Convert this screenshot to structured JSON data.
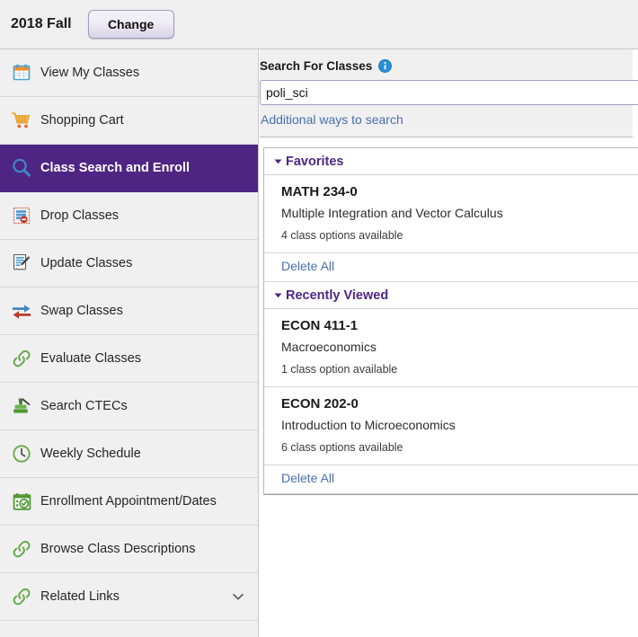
{
  "topbar": {
    "term": "2018 Fall",
    "change_label": "Change"
  },
  "sidebar": {
    "items": [
      {
        "label": "View My Classes",
        "icon": "calendar-icon",
        "active": false
      },
      {
        "label": "Shopping Cart",
        "icon": "shopping-cart-icon",
        "active": false
      },
      {
        "label": "Class Search and Enroll",
        "icon": "magnifier-icon",
        "active": true
      },
      {
        "label": "Drop Classes",
        "icon": "drop-list-icon",
        "active": false
      },
      {
        "label": "Update Classes",
        "icon": "edit-document-icon",
        "active": false
      },
      {
        "label": "Swap Classes",
        "icon": "swap-arrows-icon",
        "active": false
      },
      {
        "label": "Evaluate Classes",
        "icon": "link-chain-icon",
        "active": false
      },
      {
        "label": "Search CTECs",
        "icon": "stamp-icon",
        "active": false
      },
      {
        "label": "Weekly Schedule",
        "icon": "clock-icon",
        "active": false
      },
      {
        "label": "Enrollment Appointment/Dates",
        "icon": "calendar-check-icon",
        "active": false
      },
      {
        "label": "Browse Class Descriptions",
        "icon": "link-chain-icon",
        "active": false
      },
      {
        "label": "Related Links",
        "icon": "link-chain-icon",
        "active": false,
        "chevron": "chevron-down-icon"
      }
    ]
  },
  "search": {
    "title": "Search For Classes",
    "info_icon": "info-icon",
    "value": "poli_sci",
    "placeholder": "",
    "additional_link": "Additional ways to search"
  },
  "favorites": {
    "title": "Favorites",
    "caret": "caret-down-icon",
    "courses": [
      {
        "code": "MATH 234-0",
        "title": "Multiple Integration and Vector Calculus",
        "options": "4 class options available"
      }
    ],
    "delete_all": "Delete All"
  },
  "recently_viewed": {
    "title": "Recently Viewed",
    "caret": "caret-down-icon",
    "courses": [
      {
        "code": "ECON 411-1",
        "title": "Macroeconomics",
        "options": "1 class option available"
      },
      {
        "code": "ECON 202-0",
        "title": "Introduction to Microeconomics",
        "options": "6 class options available"
      }
    ],
    "delete_all": "Delete All"
  },
  "colors": {
    "brand_purple": "#4E2583",
    "link_blue": "#4A6FAE",
    "sidebar_bg": "#F0F0F0",
    "topbar_bg": "#EFEFEF"
  }
}
